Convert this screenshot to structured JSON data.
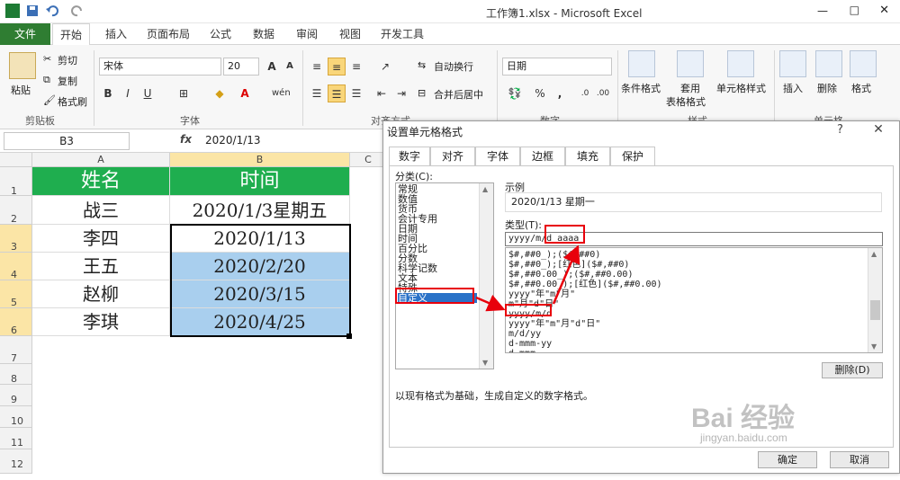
{
  "window": {
    "title": "工作簿1.xlsx  -  Microsoft Excel"
  },
  "ribbon_tabs": [
    "文件",
    "开始",
    "插入",
    "页面布局",
    "公式",
    "数据",
    "审阅",
    "视图",
    "开发工具"
  ],
  "ribbon": {
    "paste": "粘贴",
    "cut": "剪切",
    "copy": "复制",
    "format_painter": "格式刷",
    "clipboard_group": "剪贴板",
    "font_name": "宋体",
    "font_size": "20",
    "font_group": "字体",
    "wrap_text": "自动换行",
    "merge_center": "合并后居中",
    "alignment_group": "对齐方式",
    "number_format": "日期",
    "number_group": "数字",
    "conditional_format": "条件格式",
    "format_as_table_1": "套用",
    "format_as_table_2": "表格格式",
    "cell_styles": "单元格样式",
    "styles_group": "样式",
    "insert": "插入",
    "delete": "删除",
    "format": "格式",
    "cells_group": "单元格"
  },
  "formula_bar": {
    "name_box": "B3",
    "fx": "fx",
    "value": "2020/1/13"
  },
  "sheet": {
    "columns": [
      "A",
      "B",
      "C"
    ],
    "rows": [
      "1",
      "2",
      "3",
      "4",
      "5",
      "6",
      "7",
      "8",
      "9",
      "10",
      "11",
      "12"
    ],
    "header_row": {
      "a": "姓名",
      "b": "时间"
    },
    "data": [
      {
        "a": "战三",
        "b": "2020/1/3星期五"
      },
      {
        "a": "李四",
        "b": "2020/1/13"
      },
      {
        "a": "王五",
        "b": "2020/2/20"
      },
      {
        "a": "赵柳",
        "b": "2020/3/15"
      },
      {
        "a": "李琪",
        "b": "2020/4/25"
      }
    ],
    "header_fill": "#1fae4f",
    "selection_fill": "#a9cfee"
  },
  "dialog": {
    "title": "设置单元格格式",
    "help": "?",
    "close": "✕",
    "tabs": [
      "数字",
      "对齐",
      "字体",
      "边框",
      "填充",
      "保护"
    ],
    "category_label": "分类(C):",
    "categories": [
      "常规",
      "数值",
      "货币",
      "会计专用",
      "日期",
      "时间",
      "百分比",
      "分数",
      "科学记数",
      "文本",
      "特殊",
      "自定义"
    ],
    "selected_category": "自定义",
    "sample_label": "示例",
    "sample_value": "2020/1/13 星期一",
    "type_label": "类型(T):",
    "type_value": "yyyy/m/d aaaa",
    "formats": [
      "$#,##0_);($#,##0)",
      "$#,##0_);[红色]($#,##0)",
      "$#,##0.00_);($#,##0.00)",
      "$#,##0.00_);[红色]($#,##0.00)",
      "yyyy\"年\"m\"月\"",
      "m\"月\"d\"日\"",
      "yyyy/m/d",
      "yyyy\"年\"m\"月\"d\"日\"",
      "m/d/yy",
      "d-mmm-yy",
      "d-mmm"
    ],
    "delete_button": "删除(D)",
    "description": "以现有格式为基础，生成自定义的数字格式。",
    "ok": "确定",
    "cancel": "取消"
  },
  "watermark": "Bai 经验",
  "watermark_url": "jingyan.baidu.com",
  "annotation_color": "#e8000b"
}
